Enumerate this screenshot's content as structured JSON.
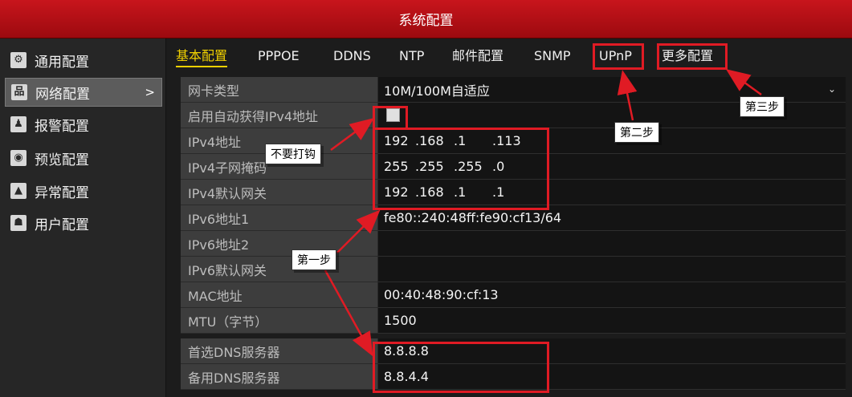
{
  "window": {
    "title": "系统配置"
  },
  "sidebar": {
    "items": [
      {
        "label": "通用配置",
        "icon": "gear-icon"
      },
      {
        "label": "网络配置",
        "icon": "network-icon",
        "chevron": ">"
      },
      {
        "label": "报警配置",
        "icon": "alarm-bell-icon"
      },
      {
        "label": "预览配置",
        "icon": "eye-icon"
      },
      {
        "label": "异常配置",
        "icon": "warning-icon"
      },
      {
        "label": "用户配置",
        "icon": "users-icon"
      }
    ]
  },
  "tabs": [
    "基本配置",
    "PPPOE",
    "DDNS",
    "NTP",
    "邮件配置",
    "SNMP",
    "UPnP",
    "更多配置"
  ],
  "form": {
    "nic_type": {
      "label": "网卡类型",
      "value": "10M/100M自适应"
    },
    "dhcp": {
      "label": "启用自动获得IPv4地址",
      "checked": false
    },
    "ipv4_addr": {
      "label": "IPv4地址",
      "segments": [
        "192",
        ".168",
        ".1",
        ".113"
      ]
    },
    "ipv4_mask": {
      "label": "IPv4子网掩码",
      "segments": [
        "255",
        ".255",
        ".255",
        ".0"
      ]
    },
    "ipv4_gw": {
      "label": "IPv4默认网关",
      "segments": [
        "192",
        ".168",
        ".1",
        ".1"
      ]
    },
    "ipv6_addr1": {
      "label": "IPv6地址1",
      "value": "fe80::240:48ff:fe90:cf13/64"
    },
    "ipv6_addr2": {
      "label": "IPv6地址2",
      "value": ""
    },
    "ipv6_gw": {
      "label": "IPv6默认网关",
      "value": ""
    },
    "mac": {
      "label": "MAC地址",
      "value": "00:40:48:90:cf:13"
    },
    "mtu": {
      "label": "MTU（字节）",
      "value": "1500"
    },
    "dns1": {
      "label": "首选DNS服务器",
      "value": "8.8.8.8"
    },
    "dns2": {
      "label": "备用DNS服务器",
      "value": "8.8.4.4"
    }
  },
  "annotations": {
    "step1": "第一步",
    "step2": "第二步",
    "step3": "第三步",
    "no_check": "不要打钩"
  },
  "colors": {
    "title_red": "#b81017",
    "highlight_red": "#e01b24",
    "active_tab": "#f0d000"
  }
}
